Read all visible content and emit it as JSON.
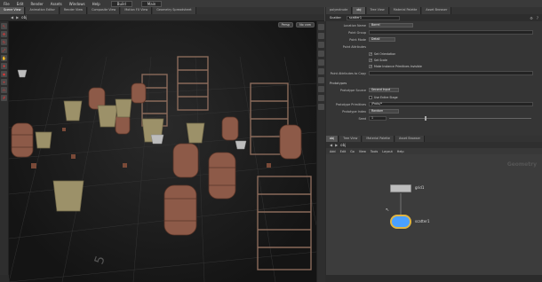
{
  "menubar": {
    "items": [
      "File",
      "Edit",
      "Render",
      "Assets",
      "Windows",
      "Help"
    ],
    "desktop": "Build",
    "shelf": "Main"
  },
  "left_tabs": [
    "Scene View",
    "Animation Editor",
    "Render View",
    "Composite View",
    "Motion FX View",
    "Geometry Spreadsheet"
  ],
  "viewport": {
    "path": "obj",
    "persp": "Persp",
    "cam": "No cam"
  },
  "right_tabs": [
    "polyextrude",
    "obj",
    "Tree View",
    "Material Palette",
    "Asset Browser"
  ],
  "params": {
    "node_type": "Scatter",
    "node_name": "scatter1",
    "rows": [
      {
        "label": "Location Name",
        "value": "Barrel",
        "kind": "menu"
      },
      {
        "label": "Point Group",
        "value": "",
        "kind": "field"
      },
      {
        "label": "Point Mode",
        "value": "Detail",
        "kind": "menu"
      },
      {
        "label": "Point Attributes",
        "value": "",
        "kind": "field"
      }
    ],
    "checks": [
      "Set Orientation",
      "Set Scale",
      "Make Instance Primitives Invisible"
    ],
    "prototype_label": "Point Attributes to Copy",
    "prototypes_header": "Prototypes",
    "prototype_source_label": "Prototype Source",
    "prototype_source_value": "Second Input",
    "use_entire_stage": "Use Entire Stage",
    "prototype_prims_label": "Prototype Primitives",
    "prototype_prims_value": "/Proto/*",
    "prototype_index_label": "Prototype Index",
    "prototype_index_value": "Random",
    "seed_label": "Seed",
    "seed_value": "1"
  },
  "network": {
    "path": "obj",
    "menu": [
      "Add",
      "Edit",
      "Go",
      "View",
      "Tools",
      "Layout",
      "Help"
    ],
    "context": "Geometry",
    "nodes": [
      {
        "label": "grid1"
      },
      {
        "label": "scatter1"
      }
    ]
  },
  "colors": {
    "accent": "#e0b441",
    "node_blue": "#4aa0ff"
  }
}
